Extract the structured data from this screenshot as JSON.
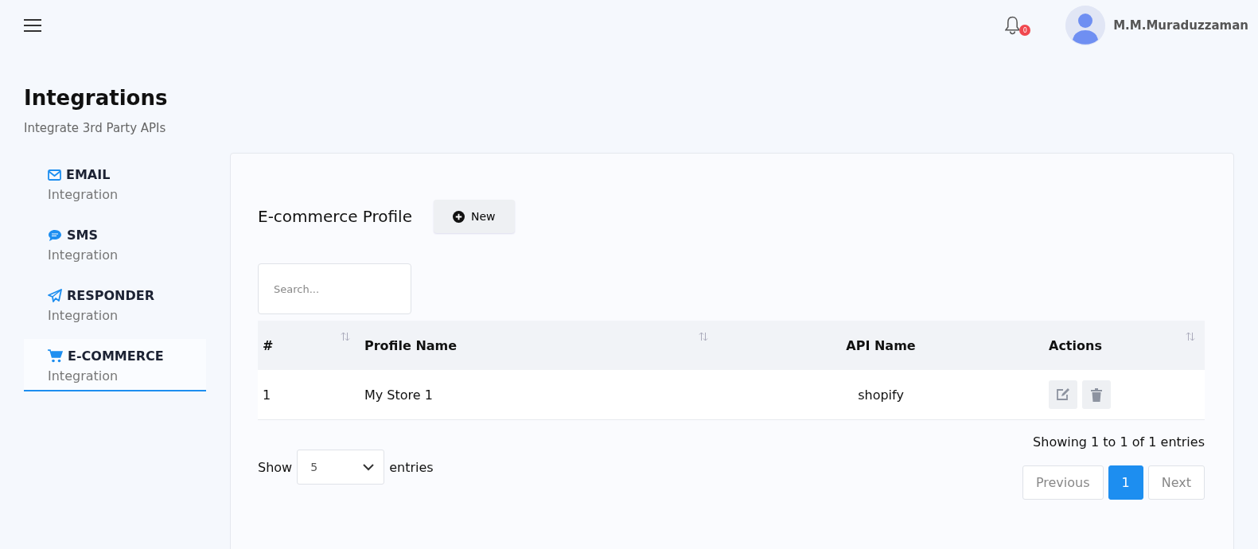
{
  "header": {
    "notifications": {
      "count": "0"
    },
    "user": {
      "name": "M.M.Muraduzzaman"
    }
  },
  "page": {
    "title": "Integrations",
    "subtitle": "Integrate 3rd Party APIs"
  },
  "sidebar": {
    "items": [
      {
        "kind": "email",
        "label": "EMAIL",
        "sublabel": "Integration",
        "selected": false
      },
      {
        "kind": "sms",
        "label": "SMS",
        "sublabel": "Integration",
        "selected": false
      },
      {
        "kind": "responder",
        "label": "RESPONDER",
        "sublabel": "Integration",
        "selected": false
      },
      {
        "kind": "ecommerce",
        "label": "E-COMMERCE",
        "sublabel": "Integration",
        "selected": true
      }
    ]
  },
  "panel": {
    "title": "E-commerce Profile",
    "new_button": "New",
    "search": {
      "placeholder": "Search..."
    },
    "table": {
      "columns": [
        {
          "label": "#",
          "sortable": true
        },
        {
          "label": "Profile Name",
          "sortable": true
        },
        {
          "label": "API Name",
          "sortable": false
        },
        {
          "label": "Actions",
          "sortable": true
        }
      ],
      "rows": [
        {
          "cells": [
            "1",
            "My Store 1",
            "shopify"
          ]
        }
      ]
    },
    "length": {
      "label_before": "Show",
      "value": "5",
      "label_after": "entries"
    },
    "info": "Showing 1 to 1 of 1 entries",
    "pagination": [
      {
        "label": "Previous",
        "disabled": true,
        "selected": false
      },
      {
        "label": "1",
        "disabled": false,
        "selected": true
      },
      {
        "label": "Next",
        "disabled": true,
        "selected": false
      }
    ]
  }
}
